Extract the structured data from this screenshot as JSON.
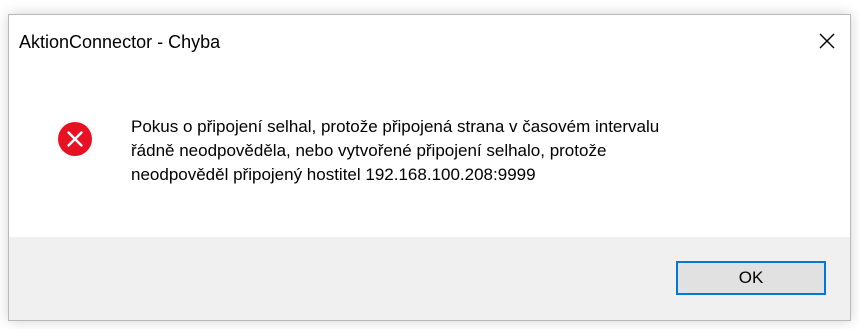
{
  "window": {
    "title": "AktionConnector - Chyba",
    "close_icon": "close-icon"
  },
  "message": {
    "icon": "error-icon",
    "icon_color": "#e81123",
    "lines": [
      "Pokus o připojení selhal, protože připojená strana v časovém intervalu",
      "řádně neodpověděla, nebo vytvořené připojení selhalo, protože",
      "neodpověděl připojený hostitel 192.168.100.208:9999"
    ]
  },
  "footer": {
    "ok_label": "OK",
    "accent_color": "#0078d7",
    "background_color": "#f0f0f0"
  }
}
